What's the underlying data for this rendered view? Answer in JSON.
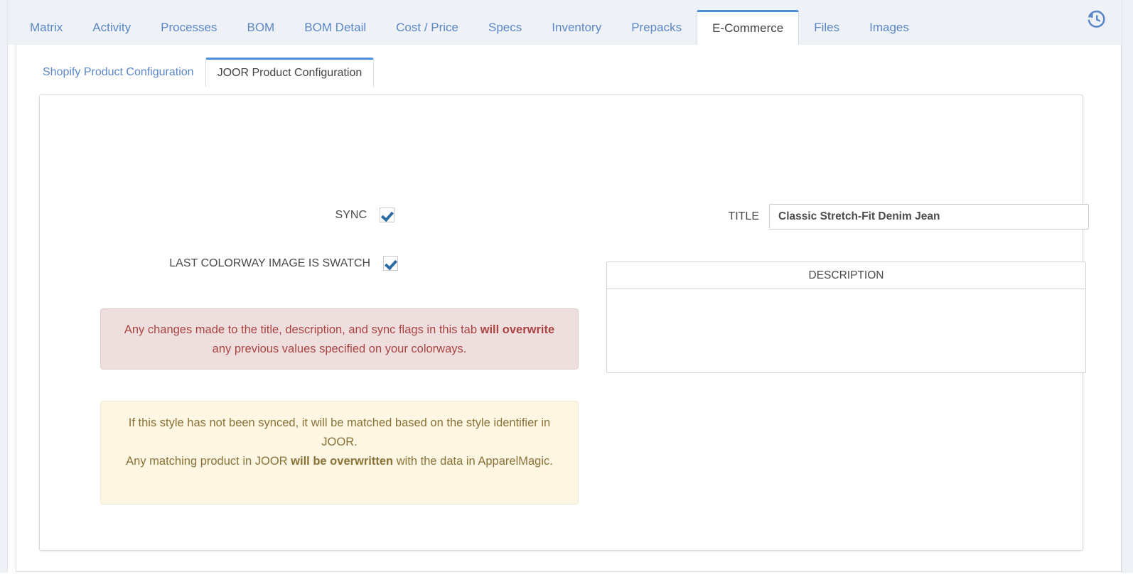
{
  "top_tabs": [
    {
      "label": "Matrix",
      "active": false
    },
    {
      "label": "Activity",
      "active": false
    },
    {
      "label": "Processes",
      "active": false
    },
    {
      "label": "BOM",
      "active": false
    },
    {
      "label": "BOM Detail",
      "active": false
    },
    {
      "label": "Cost / Price",
      "active": false
    },
    {
      "label": "Specs",
      "active": false
    },
    {
      "label": "Inventory",
      "active": false
    },
    {
      "label": "Prepacks",
      "active": false
    },
    {
      "label": "E-Commerce",
      "active": true
    },
    {
      "label": "Files",
      "active": false
    },
    {
      "label": "Images",
      "active": false
    }
  ],
  "history_icon": "history-clock-icon",
  "sub_tabs": [
    {
      "label": "Shopify Product Configuration",
      "active": false
    },
    {
      "label": "JOOR Product Configuration",
      "active": true
    }
  ],
  "form": {
    "sync": {
      "label": "SYNC",
      "checked": true,
      "checkmark": "✔"
    },
    "last_colorway_image_is_swatch": {
      "label": "LAST COLORWAY IMAGE IS SWATCH",
      "checked": true,
      "checkmark": "✔"
    },
    "title": {
      "label": "TITLE",
      "value": "Classic Stretch-Fit Denim Jean",
      "placeholder": ""
    },
    "description": {
      "label": "DESCRIPTION",
      "value": "",
      "placeholder": ""
    }
  },
  "alerts": {
    "danger": {
      "part1": "Any changes made to the title, description, and sync flags in this tab ",
      "strong": "will overwrite",
      "part2": " any previous values specified on your colorways."
    },
    "warning": {
      "part1": "If this style has not been synced, it will be matched based on the style identifier in JOOR.",
      "part2": "Any matching product in JOOR ",
      "strong": "will be overwritten",
      "part3": " with the data in ApparelMagic."
    }
  },
  "colors": {
    "tab_link": "#5b87c7",
    "active_tab_border": "#4a90d9",
    "tabstrip_bg": "#eef1f6",
    "danger_bg": "#eedede",
    "danger_text": "#a94442",
    "warning_bg": "#fcf6e3",
    "warning_text": "#8a7237",
    "checkbox_check": "#2e6da4"
  }
}
